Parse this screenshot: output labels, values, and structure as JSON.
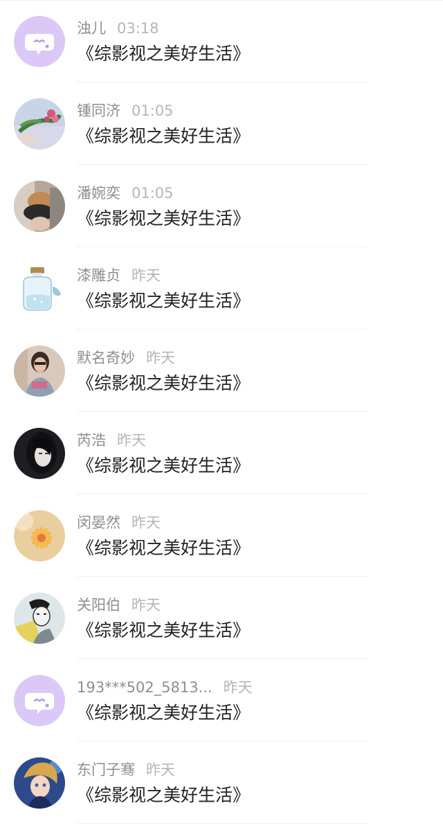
{
  "messages": [
    {
      "name": "浊儿",
      "time": "03:18",
      "text": "《综影视之美好生活》",
      "avatar": "chat-bubble-icon"
    },
    {
      "name": "锺同济",
      "time": "01:05",
      "text": "《综影视之美好生活》",
      "avatar": "flowers-photo"
    },
    {
      "name": "潘婉奕",
      "time": "01:05",
      "text": "《综影视之美好生活》",
      "avatar": "cat-photo"
    },
    {
      "name": "漆雕贞",
      "time": "昨天",
      "text": "《综影视之美好生活》",
      "avatar": "jar-photo"
    },
    {
      "name": "默名奇妙",
      "time": "昨天",
      "text": "《综影视之美好生活》",
      "avatar": "girl-photo"
    },
    {
      "name": "芮浩",
      "time": "昨天",
      "text": "《综影视之美好生活》",
      "avatar": "dark-hair-photo"
    },
    {
      "name": "闵晏然",
      "time": "昨天",
      "text": "《综影视之美好生活》",
      "avatar": "daisy-photo"
    },
    {
      "name": "关阳伯",
      "time": "昨天",
      "text": "《综影视之美好生活》",
      "avatar": "sketch-boy-photo"
    },
    {
      "name": "193***502_5813...",
      "time": "昨天",
      "text": "《综影视之美好生活》",
      "avatar": "chat-bubble-icon"
    },
    {
      "name": "东门子骞",
      "time": "昨天",
      "text": "《综影视之美好生活》",
      "avatar": "anime-boy-photo"
    }
  ],
  "colors": {
    "default_avatar_bg": "#dcc8f7",
    "name_text": "#8e8e8e",
    "time_text": "#b5b5b5",
    "message_text": "#222222",
    "divider": "#efeff1"
  }
}
